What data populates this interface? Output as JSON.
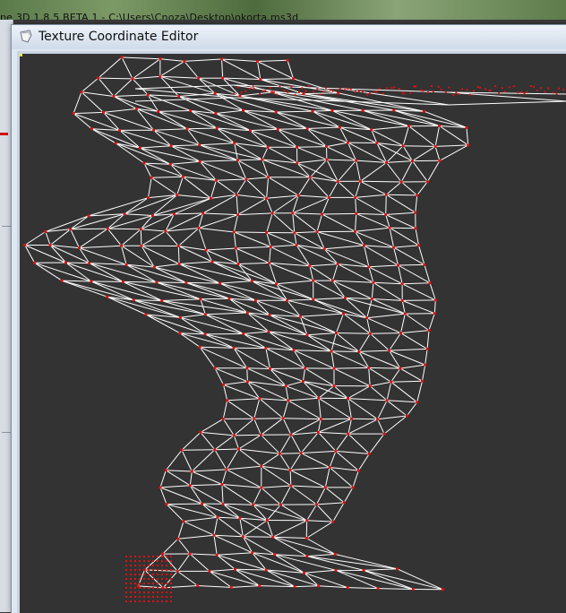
{
  "parent_window": {
    "title": "pe 3D 1.8.5 BETA 1 - C:\\Users\\Cnoza\\Desktop\\okorta.ms3d"
  },
  "editor": {
    "title": "Texture Coordinate Editor"
  },
  "colors": {
    "canvas_bg": "#333333",
    "wire": "#ffffff",
    "vertex": "#e01010",
    "selection": "#e6e640"
  },
  "icons": {
    "app": "milkshape-app-icon"
  }
}
